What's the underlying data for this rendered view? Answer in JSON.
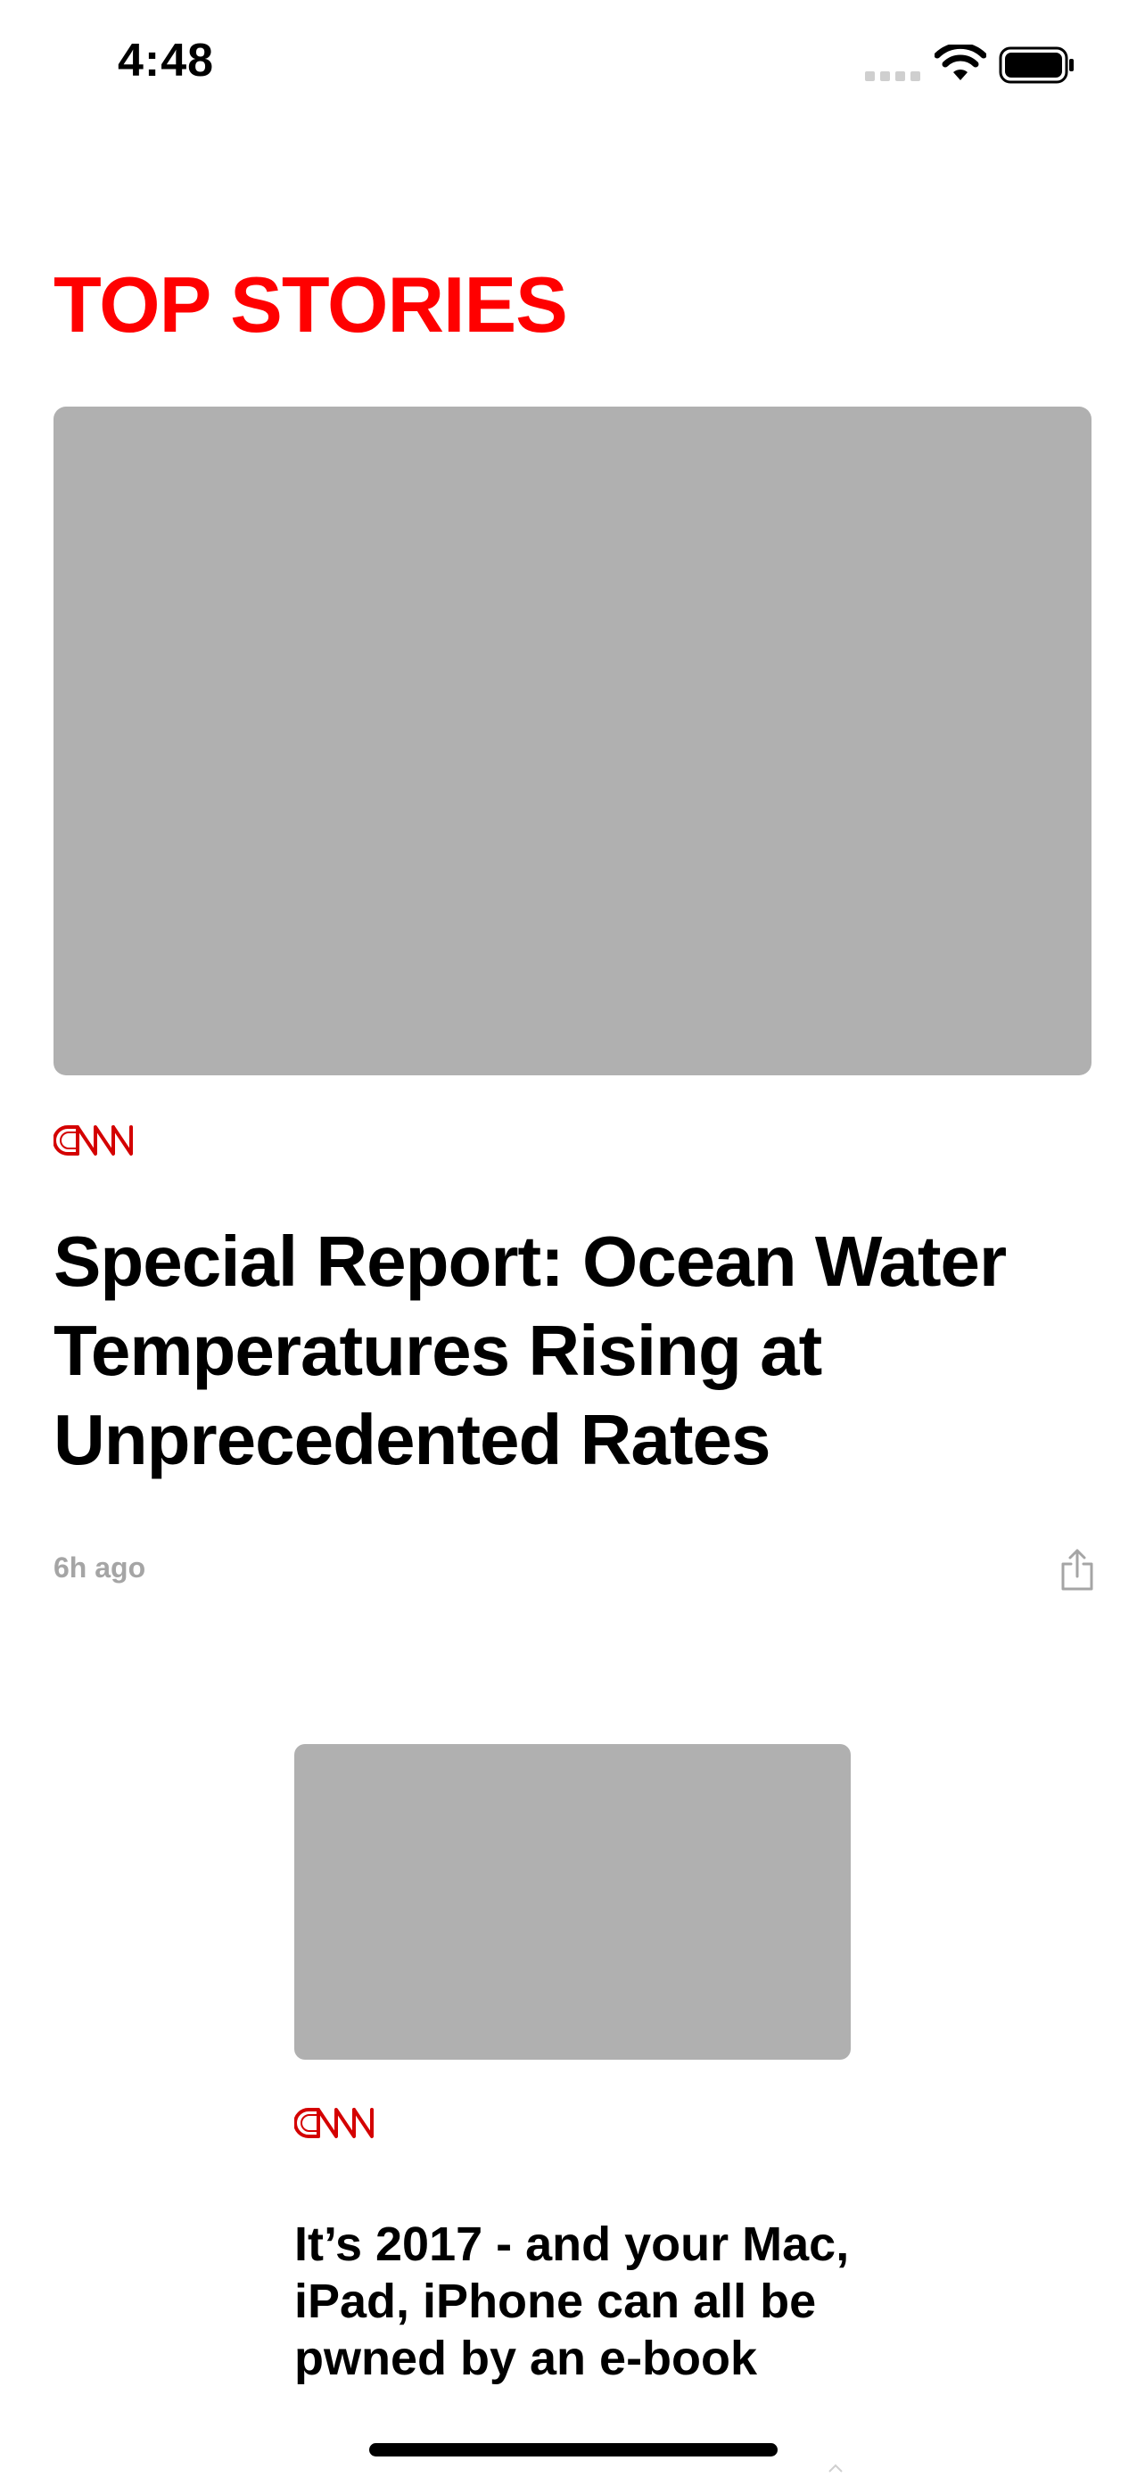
{
  "status_bar": {
    "time": "4:48",
    "icons": [
      "cellular-signal-icon",
      "wifi-icon",
      "battery-icon"
    ]
  },
  "section": {
    "title": "TOP STORIES",
    "title_color": "#ff0000"
  },
  "stories": [
    {
      "source": "CNN",
      "source_logo_color": "#d40000",
      "headline": "Special Report: Ocean Water Temperatures Rising at Unprecedented Rates",
      "time_ago": "6h ago",
      "image_placeholder_color": "#b0b0b0",
      "share_icon": "share-icon"
    },
    {
      "source": "CNN",
      "source_logo_color": "#d40000",
      "headline": "It’s 2017 - and  your Mac, iPad, iPhone can all be pwned by an e-book",
      "image_placeholder_color": "#b0b0b0"
    }
  ]
}
